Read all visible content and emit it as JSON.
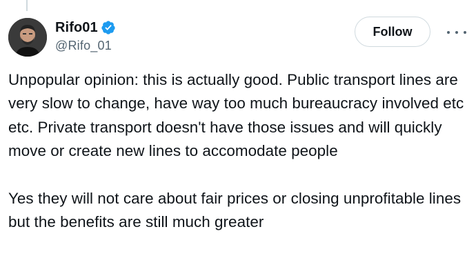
{
  "author": {
    "display_name": "Rifo01",
    "handle": "@Rifo_01",
    "verified": true,
    "avatar_icon": "avatar-photo"
  },
  "actions": {
    "follow_label": "Follow",
    "more_icon": "more-horizontal-icon"
  },
  "tweet": {
    "paragraphs": [
      "Unpopular opinion: this is actually good. Public transport lines are very slow to change, have way too much bureaucracy involved etc etc. Private transport doesn't have those issues and will quickly move or create new lines to accomodate people",
      "Yes they will not care about fair prices or closing unprofitable lines but the benefits are still much greater"
    ]
  },
  "colors": {
    "text_primary": "#0f1419",
    "text_secondary": "#536471",
    "verified_blue": "#1d9bf0",
    "border": "#cfd9de"
  }
}
